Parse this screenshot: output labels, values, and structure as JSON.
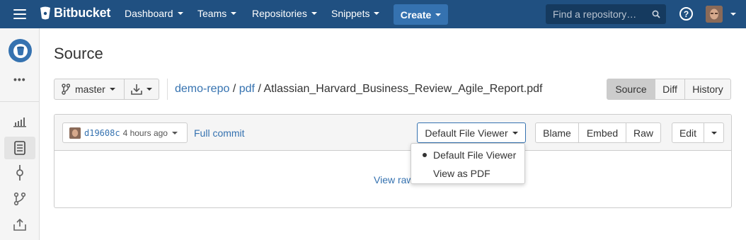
{
  "topnav": {
    "logo": "Bitbucket",
    "menus": [
      {
        "label": "Dashboard"
      },
      {
        "label": "Teams"
      },
      {
        "label": "Repositories"
      },
      {
        "label": "Snippets"
      }
    ],
    "create_label": "Create",
    "search_placeholder": "Find a repository…",
    "help": "?"
  },
  "sidebar": {
    "more": "•••",
    "items": [
      "overview-icon",
      "source-icon",
      "commits-icon",
      "branches-icon",
      "pull-requests-icon"
    ]
  },
  "page": {
    "title": "Source",
    "branch": "master",
    "breadcrumb": {
      "repo": "demo-repo",
      "sep1": "/",
      "folder": "pdf",
      "sep2": "/",
      "file": "Atlassian_Harvard_Business_Review_Agile_Report.pdf"
    },
    "view_modes": [
      "Source",
      "Diff",
      "History"
    ],
    "active_view": "Source"
  },
  "file_panel": {
    "commit_hash": "d19608c",
    "commit_time": "4 hours ago",
    "full_commit": "Full commit",
    "viewer_label": "Default File Viewer",
    "actions": [
      "Blame",
      "Embed",
      "Raw"
    ],
    "edit_label": "Edit",
    "view_raw": "View raw"
  },
  "viewer_dropdown": {
    "options": [
      "Default File Viewer",
      "View as PDF"
    ],
    "selected": "Default File Viewer"
  },
  "colors": {
    "nav_bg": "#205081",
    "accent": "#3572b0",
    "link": "#3572b0"
  }
}
